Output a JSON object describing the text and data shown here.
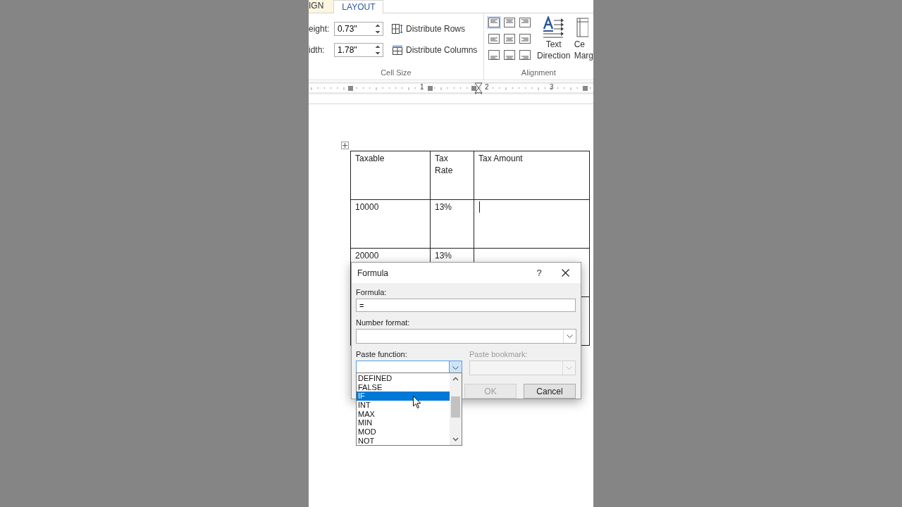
{
  "ribbon": {
    "tabs": [
      {
        "label": "IGN",
        "selected": false
      },
      {
        "label": "LAYOUT",
        "selected": true
      }
    ],
    "cell_size": {
      "fields": [
        {
          "label": "eight:",
          "value": "0.73\""
        },
        {
          "label": "idth:",
          "value": "1.78\""
        }
      ],
      "buttons": [
        {
          "label": "Distribute Rows",
          "kind": "rows"
        },
        {
          "label": "Distribute Columns",
          "kind": "columns"
        }
      ],
      "group_label": "Cell Size"
    },
    "alignment": {
      "cells": [
        {
          "selected": true
        },
        {
          "selected": false
        },
        {
          "selected": false
        },
        {
          "selected": false
        },
        {
          "selected": false
        },
        {
          "selected": false
        },
        {
          "selected": false
        },
        {
          "selected": false
        },
        {
          "selected": false
        }
      ],
      "text_direction": "Text Direction",
      "cut_button": [
        "Ce",
        "Marg"
      ],
      "group_label": "Alignment"
    }
  },
  "ruler": {
    "numbers": [
      "1",
      "2",
      "3"
    ]
  },
  "table": {
    "rows": [
      [
        {
          "text": "Taxable"
        },
        {
          "text": "Tax Rate"
        },
        {
          "text": "Tax Amount"
        }
      ],
      [
        {
          "text": "10000"
        },
        {
          "text": "13%"
        },
        {
          "caret": true
        }
      ],
      [
        {
          "text": "20000"
        },
        {
          "text": "13%"
        },
        {}
      ],
      [
        {},
        {},
        {}
      ]
    ]
  },
  "dialog": {
    "title": "Formula",
    "help": "?",
    "formula": {
      "label": "Formula:",
      "value": "="
    },
    "number_format": {
      "label": "Number format:"
    },
    "paste_function": {
      "label": "Paste function:",
      "open": true,
      "items": [
        {
          "label": "DEFINED",
          "selected": false
        },
        {
          "label": "FALSE",
          "selected": false
        },
        {
          "label": "IF",
          "selected": true
        },
        {
          "label": "INT",
          "selected": false
        },
        {
          "label": "MAX",
          "selected": false
        },
        {
          "label": "MIN",
          "selected": false
        },
        {
          "label": "MOD",
          "selected": false
        },
        {
          "label": "NOT",
          "selected": false
        }
      ]
    },
    "paste_bookmark": {
      "label": "Paste bookmark:",
      "disabled": true
    },
    "buttons": [
      {
        "label": "OK",
        "disabled": true
      },
      {
        "label": "Cancel",
        "disabled": false
      }
    ]
  }
}
